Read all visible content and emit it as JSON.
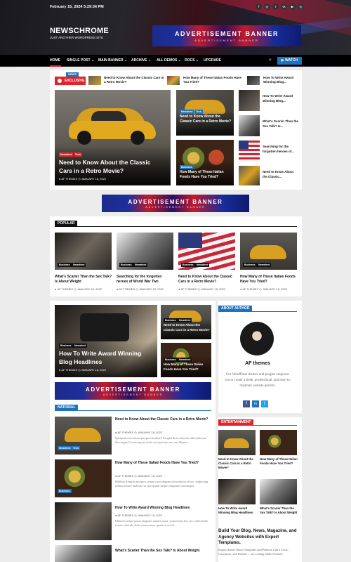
{
  "header": {
    "date": "February 15, 2024 5:29:34 PM",
    "site_title": "NEWSCHROME",
    "tagline": "JUST ANOTHER WORDPRESS SITE",
    "social_icons": [
      "facebook-icon",
      "instagram-icon",
      "twitter-icon",
      "vk-icon",
      "youtube-icon",
      "instagram-icon"
    ],
    "ad_banner": {
      "title": "ADVERTISEMENT BANNER",
      "subtitle": "ADVERTISEMENT BANNER"
    }
  },
  "nav": {
    "items": [
      "HOME",
      "SINGLE POST ⌄",
      "MAIN BANNER ⌄",
      "ARCHIVE ⌄",
      "ALL DEMOS ⌄",
      "DOCS ⌄",
      "UPGRADE"
    ],
    "search_icon": "search-icon",
    "watch_label": "WATCH"
  },
  "ticker": {
    "news_label": "NEWS",
    "exclusive_label": "EXCLUSIVE",
    "items": [
      "Need to Know About the Classic Cars in a Retro Movie?",
      "How Many of These Italian Foods Have You Tried?",
      "How To Write Award Winning Blog..."
    ]
  },
  "featured": {
    "main": {
      "tags": [
        "Newsfeed",
        "Tech"
      ],
      "title": "Need to Know About the Classic Cars in a Retro Movie?",
      "author": "AF THEMES",
      "date": "JANUARY 18, 2022"
    },
    "mid": [
      {
        "tags": [
          "Newsfeed",
          "Tech"
        ],
        "title": "Need to Know About the Classic Cars in a Retro Movie?"
      },
      {
        "tags": [
          "Business"
        ],
        "title": "How Many of These Italian Foods Have You Tried?"
      }
    ],
    "side": [
      "How To Write Award Winning Blog...",
      "What's Scarier Than the Sex Talk? Is...",
      "Searching for the forgotten heroes of...",
      "Need to Know About the Classic..."
    ]
  },
  "popular": {
    "heading": "POPULAR",
    "items": [
      {
        "tags": [
          "Business",
          "Newsfeed"
        ],
        "title": "What's Scarier Than the Sex Talk? Is About Weight",
        "author": "AF THEMES",
        "date": "JANUARY 18, 2022"
      },
      {
        "tags": [
          "Business",
          "Newsfeed"
        ],
        "title": "Searching for the forgotten heroes of World War Two",
        "author": "AF THEMES",
        "date": "JANUARY 18, 2022"
      },
      {
        "tags": [
          "Business",
          "Newsfeed"
        ],
        "title": "Need to Know About the Classic Cars in a Retro Movie?",
        "author": "AF THEMES",
        "date": "JANUARY 18, 2022"
      },
      {
        "tags": [
          "Business",
          "Newsfeed"
        ],
        "title": "How Many of These Italian Foods Have You Tried?",
        "author": "AF THEMES",
        "date": "JANUARY 18, 2022"
      }
    ]
  },
  "mid_section": {
    "big": {
      "tags": [
        "Business",
        "Newsfeed"
      ],
      "title": "How To Write Award Winning Blog Headlines",
      "author": "AF THEMES",
      "date": "JANUARY 18, 2022"
    },
    "small": [
      {
        "tags": [
          "Business",
          "Newsfeed"
        ],
        "title": "Need to Know About the Classic Cars in a Retro Movie?"
      },
      {
        "tags": [
          "Business",
          "Newsfeed"
        ],
        "title": "How Many of These Italian Foods Have You Tried?"
      }
    ]
  },
  "about": {
    "heading": "ABOUT AUTHOR",
    "name": "AF themes",
    "bio": "Our WordPress themes and plugins empower you to create a sleek, professional, and easy-to-maintain website quickly."
  },
  "national": {
    "heading": "NATIONAL",
    "items": [
      {
        "tags": [
          "Newsfeed",
          "Tech"
        ],
        "title": "Need to Know About the Classic Cars in a Retro Movie?",
        "author": "AF THEMES",
        "date": "JANUARY 18, 2022",
        "excerpt": "Quisquam ut rutrum quisque tincidunt! Feugiat dicta nascetur nibh placerat. Nec turpis! Lorem ipsum dolor sit amet, nec nec eu ullamco..."
      },
      {
        "tags": [
          "Business"
        ],
        "title": "How Many of These Italian Foods Have You Tried?",
        "author": "AF THEMES",
        "date": "JANUARY 18, 2022",
        "excerpt": "Mollitia fringilla inceptos ornare cum aliquam exercitation id nec, adipiscing rutrum ornare molestie so quo ipsum neque voluptates mi tempor."
      },
      {
        "tags": [],
        "title": "How To Write Award Winning Blog Headlines",
        "author": "AF THEMES",
        "date": "JANUARY 18, 2022",
        "excerpt": "Ullamco neque purus magnam mauris porta, consectetur leo, nec sollicitudin forum vehicula dolor massa urna, quam ut vel sit..."
      },
      {
        "tags": [],
        "title": "What's Scarier Than the Sex Talk? Is About Weight",
        "author": "",
        "date": "",
        "excerpt": ""
      }
    ]
  },
  "entertainment": {
    "heading": "ENTERTAINMENT",
    "items": [
      "Need to Know About the Classic Cars in a Retro Movie?",
      "How Many of These Italian Foods Have You Tried?",
      "How To Write Award Winning Blog Headlines",
      "What's Scarier Than the Sex Talk? Is About Weight"
    ]
  },
  "promo": {
    "title": "Build Your Blog, News, Magazine, and Agency Websites with Expert Templates.",
    "text": "Import Starter Demo Templates and Patterns with a Click, Customize, and Publish — no Coding Skills Needed!"
  },
  "colors": {
    "accent_red": "#e2232a",
    "accent_blue": "#1e73be",
    "nav_bg": "#000000",
    "body_bg": "#ececec"
  }
}
